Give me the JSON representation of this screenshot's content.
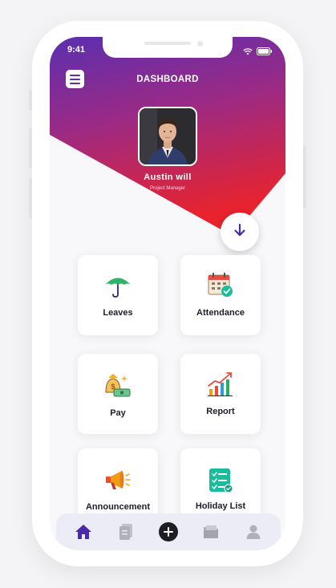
{
  "status_bar": {
    "time": "9:41"
  },
  "header": {
    "title": "DASHBOARD",
    "menu_icon": "hamburger-menu-icon"
  },
  "profile": {
    "name": "Austin will",
    "role": "Project Manager"
  },
  "cards": [
    {
      "label": "Leaves",
      "icon": "umbrella-icon"
    },
    {
      "label": "Attendance",
      "icon": "calendar-check-icon"
    },
    {
      "label": "Pay",
      "icon": "money-bag-icon"
    },
    {
      "label": "Report",
      "icon": "growth-chart-icon"
    },
    {
      "label": "Announcement",
      "icon": "megaphone-icon"
    },
    {
      "label": "Holiday List",
      "icon": "checklist-icon"
    }
  ],
  "bottom_nav": [
    {
      "icon": "home-icon",
      "active": true
    },
    {
      "icon": "document-icon",
      "active": false
    },
    {
      "icon": "plus-icon",
      "active": false
    },
    {
      "icon": "folder-icon",
      "active": false
    },
    {
      "icon": "user-icon",
      "active": false
    }
  ],
  "colors": {
    "gradient_top": "#5b2fb0",
    "gradient_bottom": "#e8232d",
    "accent": "#4b2aa8",
    "nav_background": "#ececf6"
  }
}
